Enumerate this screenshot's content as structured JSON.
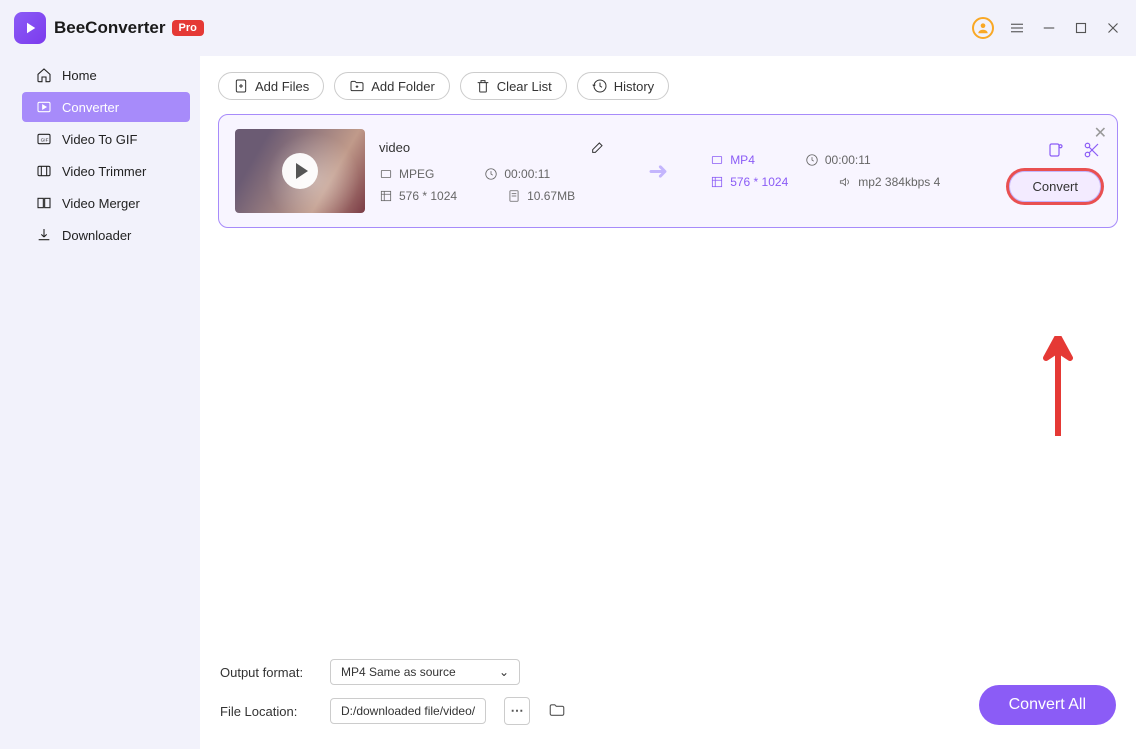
{
  "app": {
    "name": "BeeConverter",
    "badge": "Pro"
  },
  "sidebar": {
    "items": [
      {
        "label": "Home"
      },
      {
        "label": "Converter"
      },
      {
        "label": "Video To GIF"
      },
      {
        "label": "Video Trimmer"
      },
      {
        "label": "Video Merger"
      },
      {
        "label": "Downloader"
      }
    ]
  },
  "toolbar": {
    "add_files": "Add Files",
    "add_folder": "Add Folder",
    "clear_list": "Clear List",
    "history": "History"
  },
  "file": {
    "title": "video",
    "src": {
      "format": "MPEG",
      "duration": "00:00:11",
      "resolution": "576 * 1024",
      "size": "10.67MB"
    },
    "dst": {
      "format": "MP4",
      "duration": "00:00:11",
      "resolution": "576 * 1024",
      "audio": "mp2 384kbps 4"
    },
    "convert_label": "Convert"
  },
  "bottom": {
    "output_label": "Output format:",
    "output_value": "MP4 Same as source",
    "location_label": "File Location:",
    "location_value": "D:/downloaded file/video/",
    "convert_all": "Convert All"
  }
}
